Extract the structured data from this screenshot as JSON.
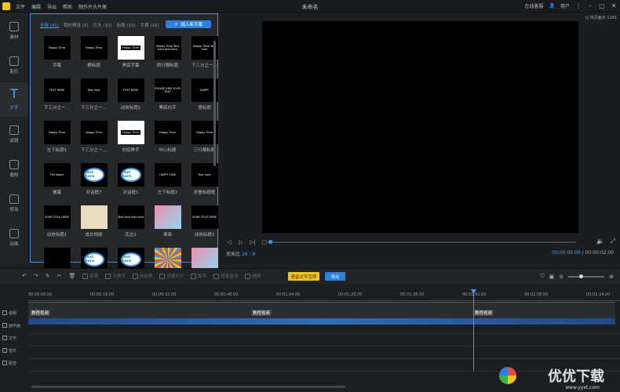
{
  "titlebar": {
    "menu": [
      "文件",
      "编辑",
      "导出",
      "帮助",
      "制作片头片尾"
    ],
    "title": "未命名",
    "online_help": "在线客服",
    "user": "用户"
  },
  "sidebar": {
    "items": [
      {
        "label": "素材",
        "icon": "media-icon"
      },
      {
        "label": "配乐",
        "icon": "music-icon"
      },
      {
        "label": "文字",
        "icon": "text-icon",
        "active": true
      },
      {
        "label": "滤镜",
        "icon": "filter-icon"
      },
      {
        "label": "叠附",
        "icon": "overlay-icon"
      },
      {
        "label": "转场",
        "icon": "transition-icon"
      },
      {
        "label": "动画",
        "icon": "animation-icon"
      }
    ]
  },
  "library": {
    "tabs": [
      "全部 (41)",
      "我的预设 (0)",
      "片头 (10)",
      "标题 (15)",
      "字幕 (16)"
    ],
    "add_button": "插入新字幕",
    "cards": [
      {
        "label": "字幕",
        "thumb": "Happy Time",
        "style": "black"
      },
      {
        "label": "横标题",
        "thumb": "Happy Time",
        "style": "black"
      },
      {
        "label": "黑底字幕",
        "thumb": "Happy Time",
        "style": "white"
      },
      {
        "label": "两行横标题",
        "thumb": "Happy Time Text here text here",
        "style": "black"
      },
      {
        "label": "下三分之一…",
        "thumb": "Happy Time Text here",
        "style": "black"
      },
      {
        "label": "下三分之一…",
        "thumb": "TEXT HERE",
        "style": "black"
      },
      {
        "label": "下三分之一…",
        "thumb": "Text here",
        "style": "black"
      },
      {
        "label": "动效标题2",
        "thumb": "TEXT HERE",
        "style": "black"
      },
      {
        "label": "黑底白字",
        "thumb": "PLEASE ADD YOUR TEXT",
        "style": "black"
      },
      {
        "label": "竖标题",
        "thumb": "HAPPY",
        "style": "black"
      },
      {
        "label": "左下标题1",
        "thumb": "Happy Time",
        "style": "black"
      },
      {
        "label": "下三分之一…",
        "thumb": "Happy Time",
        "style": "black"
      },
      {
        "label": "白底黑字",
        "thumb": "Happy Time",
        "style": "white"
      },
      {
        "label": "中心标题",
        "thumb": "Happy Time",
        "style": "black"
      },
      {
        "label": "三行横标题",
        "thumb": "Happy Time",
        "style": "black"
      },
      {
        "label": "署幕",
        "thumb": "The Name",
        "style": "black"
      },
      {
        "label": "对话框7",
        "thumb": "Text here",
        "style": "bubble"
      },
      {
        "label": "对话框1",
        "thumb": "Text here",
        "style": "bubble"
      },
      {
        "label": "左下标题2",
        "thumb": "HAPPY TIME",
        "style": "black"
      },
      {
        "label": "折叠标题框",
        "thumb": "Text here",
        "style": "black"
      },
      {
        "label": "动效标题1",
        "thumb": "YOUR TITLE HERE",
        "style": "black"
      },
      {
        "label": "成长相册",
        "thumb": "",
        "style": "paper"
      },
      {
        "label": "花边2",
        "thumb": "Text here text here",
        "style": "black"
      },
      {
        "label": "晕染",
        "thumb": "",
        "style": "pink"
      },
      {
        "label": "动效标题3",
        "thumb": "YOUR TITLE HERE",
        "style": "black"
      },
      {
        "label": "",
        "thumb": "",
        "style": "black"
      },
      {
        "label": "",
        "thumb": "Text here",
        "style": "bubble"
      },
      {
        "label": "",
        "thumb": "Text here",
        "style": "bubble"
      },
      {
        "label": "",
        "thumb": "",
        "style": "burst"
      },
      {
        "label": "",
        "thumb": "",
        "style": "pink"
      }
    ]
  },
  "preview": {
    "aspect_note": "◎ 该页面示 1141",
    "ratio_label": "宽高比",
    "ratio_value": "16 : 9",
    "time_current": "00:00:00.00",
    "time_total": "00:00:02.00",
    "progress": 0
  },
  "toolbar": {
    "tools": [
      "剪裁",
      "马赛克",
      "冻结帧",
      "设置时长",
      "配乐",
      "修复音频",
      "缩放"
    ],
    "voice_button": "语音文字互转",
    "export_button": "导出",
    "zoom_level": 0.35
  },
  "timeline": {
    "ticks": [
      "00:00:00.00",
      "00:00:16.00",
      "00:00:32.00",
      "00:00:48.00",
      "00:01:04.00",
      "00:01:20.00",
      "00:01:36.00",
      "00:01:52.00",
      "00:02:08.00",
      "00:02:24.00"
    ],
    "tracks": [
      "视频",
      "画中画",
      "文字",
      "音乐",
      "配音"
    ],
    "clip_labels": [
      "教程视频",
      "教程视频",
      "教程视频"
    ]
  },
  "watermark": {
    "text": "优优下载",
    "url": "www.yyxt.com"
  },
  "colors": {
    "accent": "#2f7fde",
    "highlight": "#f5c518",
    "background": "#1e1f22"
  }
}
